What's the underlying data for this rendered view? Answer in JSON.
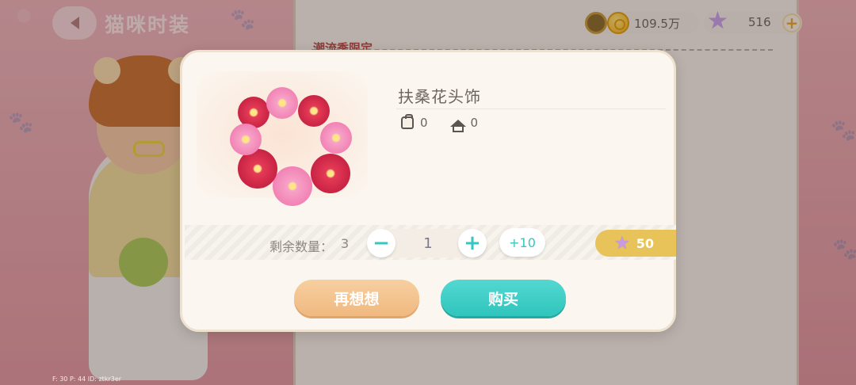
{
  "header": {
    "title": "猫咪时装"
  },
  "background_panel": {
    "section_title": "潮流季限定"
  },
  "currency": {
    "coins": "109.5万",
    "stars": "516",
    "coin_icon": "gold-coin-icon",
    "star_icon": "purple-star-icon",
    "add_icon": "plus-icon"
  },
  "dialog": {
    "item_name": "扶桑花头饰",
    "owned_bag": "0",
    "owned_home": "0",
    "remaining_label": "剩余数量：",
    "remaining_value": "3",
    "quantity": "1",
    "plus_ten": "+10",
    "price": "50",
    "cancel_label": "再想想",
    "buy_label": "购买"
  },
  "debug_text": "F: 30    P: 44    ID: ztkr3er",
  "colors": {
    "accent_teal": "#37c7c2",
    "buy_button": "#2fc5bd",
    "cancel_button": "#f0b980",
    "price_tag": "#e8c35a"
  }
}
